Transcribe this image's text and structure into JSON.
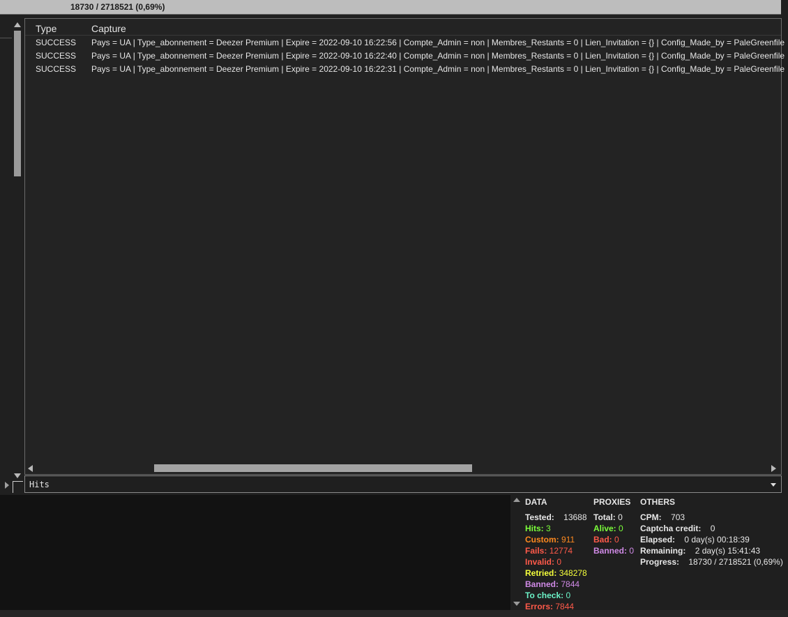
{
  "progress": {
    "text": "18730 / 2718521 (0,69%)"
  },
  "table": {
    "headers": {
      "type": "Type",
      "capture": "Capture"
    },
    "rows": [
      {
        "type": "SUCCESS",
        "capture": "Pays = UA | Type_abonnement = Deezer Premium | Expire = 2022-09-10 16:22:56 | Compte_Admin = non | Membres_Restants = 0 | Lien_Invitation = {} | Config_Made_by = PaleGreenfile"
      },
      {
        "type": "SUCCESS",
        "capture": "Pays = UA | Type_abonnement = Deezer Premium | Expire = 2022-09-10 16:22:40 | Compte_Admin = non | Membres_Restants = 0 | Lien_Invitation = {} | Config_Made_by = PaleGreenfile"
      },
      {
        "type": "SUCCESS",
        "capture": "Pays = UA | Type_abonnement = Deezer Premium | Expire = 2022-09-10 16:22:31 | Compte_Admin = non | Membres_Restants = 0 | Lien_Invitation = {} | Config_Made_by = PaleGreenfile"
      }
    ]
  },
  "dropdown": {
    "value": "Hits"
  },
  "stats": {
    "data": {
      "title": "DATA",
      "tested": {
        "label": "Tested:",
        "value": "13688"
      },
      "hits": {
        "label": "Hits:",
        "value": "3"
      },
      "custom": {
        "label": "Custom:",
        "value": "911"
      },
      "fails": {
        "label": "Fails:",
        "value": "12774"
      },
      "invalid": {
        "label": "Invalid:",
        "value": "0"
      },
      "retried": {
        "label": "Retried:",
        "value": "348278"
      },
      "banned": {
        "label": "Banned:",
        "value": "7844"
      },
      "to_check": {
        "label": "To check:",
        "value": "0"
      },
      "errors": {
        "label": "Errors:",
        "value": "7844"
      }
    },
    "proxies": {
      "title": "PROXIES",
      "total": {
        "label": "Total:",
        "value": "0"
      },
      "alive": {
        "label": "Alive:",
        "value": "0"
      },
      "bad": {
        "label": "Bad:",
        "value": "0"
      },
      "banned": {
        "label": "Banned:",
        "value": "0"
      }
    },
    "others": {
      "title": "OTHERS",
      "cpm": {
        "label": "CPM:",
        "value": "703"
      },
      "captcha": {
        "label": "Captcha credit:",
        "value": "0"
      },
      "elapsed": {
        "label": "Elapsed:",
        "value": "0 day(s) 00:18:39"
      },
      "remaining": {
        "label": "Remaining:",
        "value": "2 day(s) 15:41:43"
      },
      "progress": {
        "label": "Progress:",
        "value": "18730 / 2718521 (0,69%)"
      }
    }
  },
  "colors": {
    "hits": "#7cff3b",
    "custom": "#ff8a1f",
    "fails": "#ff5a4a",
    "retried": "#f5ff3b",
    "banned": "#d08ae6",
    "to_check": "#6cf3c8"
  }
}
